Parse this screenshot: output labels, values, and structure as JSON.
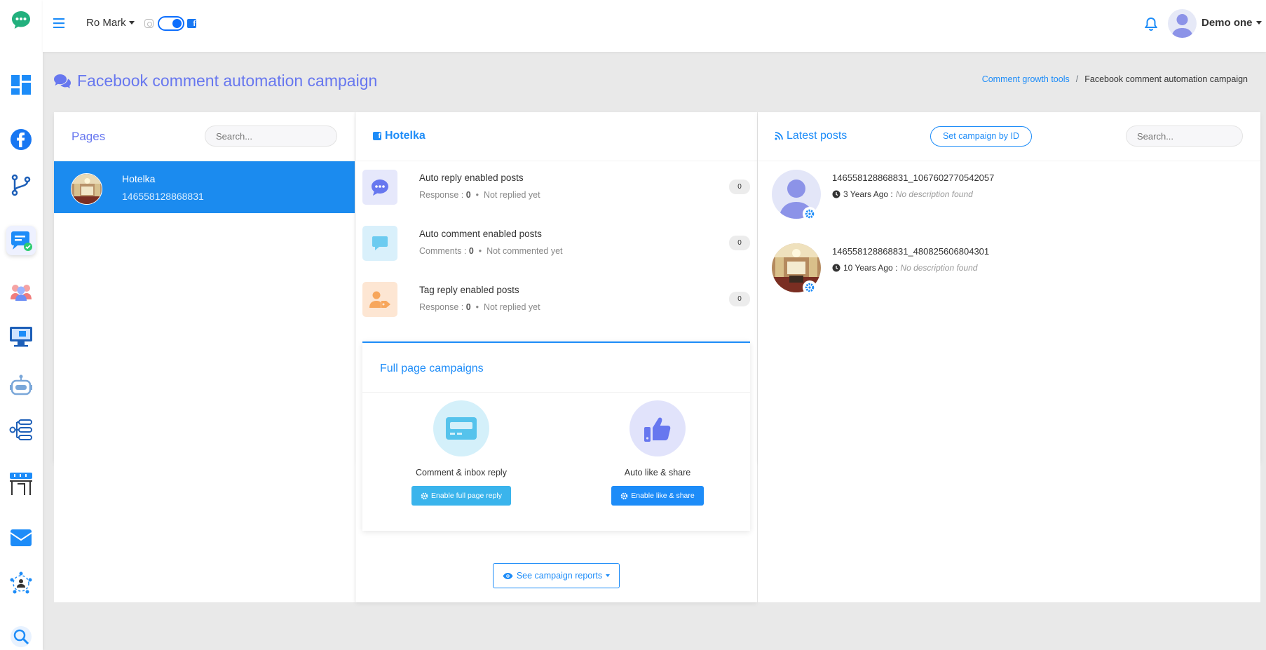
{
  "topbar": {
    "account_name": "Ro Mark",
    "user_name": "Demo one"
  },
  "page": {
    "title": "Facebook comment automation campaign",
    "breadcrumb": [
      "Comment growth tools",
      "/",
      "Facebook comment automation campaign"
    ]
  },
  "pages_panel": {
    "title": "Pages",
    "search_placeholder": "Search...",
    "items": [
      {
        "name": "Hotelka",
        "id": "146558128868831",
        "selected": true
      }
    ]
  },
  "middle_panel": {
    "page_title": "Hotelka",
    "stats": [
      {
        "title": "Auto reply enabled posts",
        "sub_label": "Response :",
        "sub_value": "0",
        "sub_status": "Not replied yet",
        "count": "0",
        "icon": "chat-bubble-icon"
      },
      {
        "title": "Auto comment enabled posts",
        "sub_label": "Comments :",
        "sub_value": "0",
        "sub_status": "Not commented yet",
        "count": "0",
        "icon": "comment-icon"
      },
      {
        "title": "Tag reply enabled posts",
        "sub_label": "Response :",
        "sub_value": "0",
        "sub_status": "Not replied yet",
        "count": "0",
        "icon": "user-tag-icon"
      }
    ],
    "full_page": {
      "title": "Full page campaigns",
      "options": [
        {
          "label": "Comment & inbox reply",
          "button": "Enable full page reply",
          "icon": "card-icon"
        },
        {
          "label": "Auto like & share",
          "button": "Enable like & share",
          "icon": "thumbs-up-icon"
        }
      ]
    },
    "report_button": "See campaign reports"
  },
  "right_panel": {
    "title": "Latest posts",
    "set_button": "Set campaign by ID",
    "search_placeholder": "Search...",
    "posts": [
      {
        "id": "146558128868831_1067602770542057",
        "age": "3 Years Ago :",
        "desc": "No description found",
        "thumb": "avatar"
      },
      {
        "id": "146558128868831_480825606804301",
        "age": "10 Years Ago :",
        "desc": "No description found",
        "thumb": "photo"
      }
    ]
  },
  "colors": {
    "primary": "#1d8cf8",
    "title_purple": "#6777ef",
    "selected_row": "#1b8bef"
  }
}
